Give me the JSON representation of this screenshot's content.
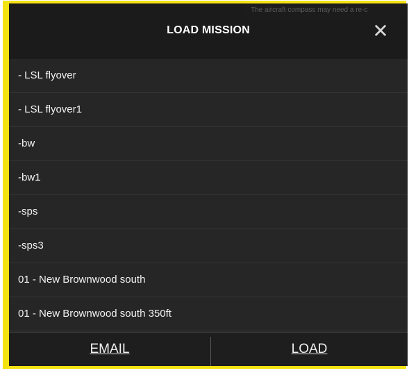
{
  "toast": {
    "text": "The aircraft compass may need a re-c"
  },
  "dialog": {
    "title": "LOAD MISSION",
    "close_icon": "close-icon"
  },
  "missions": [
    "- LSL flyover",
    "- LSL flyover1",
    "-bw",
    "-bw1",
    "-sps",
    "-sps3",
    "01 - New Brownwood south",
    "01 - New Brownwood south 350ft"
  ],
  "footer": {
    "email_label": "EMAIL",
    "load_label": "LOAD"
  },
  "colors": {
    "highlight_border": "#f4e312",
    "dialog_bg": "#262626",
    "header_bg": "#1b1b1b"
  }
}
